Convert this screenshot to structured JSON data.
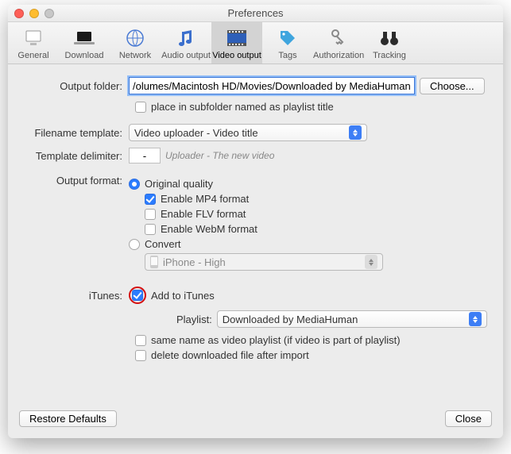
{
  "window_title": "Preferences",
  "tabs": {
    "general": "General",
    "download": "Download",
    "network": "Network",
    "audio": "Audio output",
    "video": "Video output",
    "tags": "Tags",
    "auth": "Authorization",
    "tracking": "Tracking"
  },
  "labels": {
    "output_folder": "Output folder:",
    "filename_template": "Filename template:",
    "template_delimiter": "Template delimiter:",
    "output_format": "Output format:",
    "itunes": "iTunes:",
    "playlist": "Playlist:"
  },
  "values": {
    "output_folder": "/olumes/Macintosh HD/Movies/Downloaded by MediaHuman",
    "delimiter": "-",
    "filename_template": "Video uploader - Video title",
    "delimiter_hint": "Uploader - The new video",
    "convert_preset": "iPhone - High",
    "playlist": "Downloaded by MediaHuman"
  },
  "checks": {
    "subfolder": "place in subfolder named as playlist title",
    "mp4": "Enable MP4 format",
    "flv": "Enable FLV format",
    "webm": "Enable WebM format",
    "original": "Original quality",
    "convert": "Convert",
    "addtoitunes": "Add to iTunes",
    "same_name": "same name as video playlist (if video is part of playlist)",
    "delete_after": "delete downloaded file after import"
  },
  "buttons": {
    "choose": "Choose...",
    "restore": "Restore Defaults",
    "close": "Close"
  }
}
